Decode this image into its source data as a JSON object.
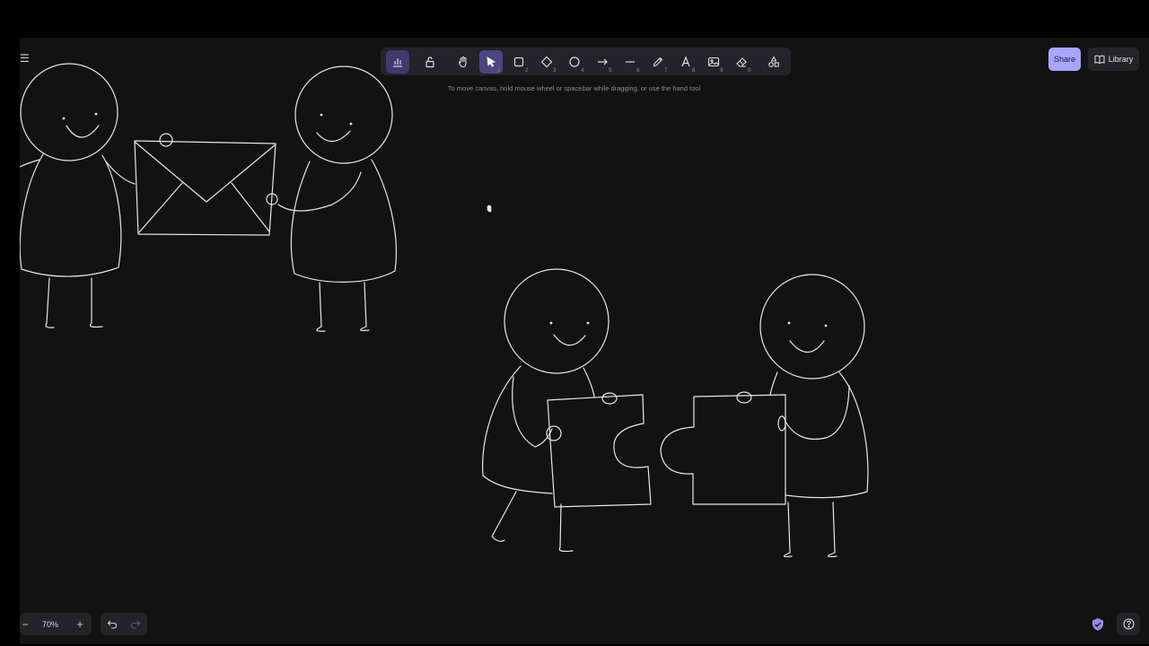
{
  "toolbar": {
    "tools": [
      {
        "id": "lock-toggle",
        "icon": "keep-tool-active-icon",
        "shortcut": ""
      },
      {
        "id": "lock",
        "icon": "lock-open-icon",
        "shortcut": ""
      },
      {
        "id": "hand",
        "icon": "hand-icon",
        "shortcut": ""
      },
      {
        "id": "selection",
        "icon": "cursor-icon",
        "shortcut": "1"
      },
      {
        "id": "rectangle",
        "icon": "square-icon",
        "shortcut": "2"
      },
      {
        "id": "diamond",
        "icon": "diamond-icon",
        "shortcut": "3"
      },
      {
        "id": "ellipse",
        "icon": "circle-icon",
        "shortcut": "4"
      },
      {
        "id": "arrow",
        "icon": "arrow-icon",
        "shortcut": "5"
      },
      {
        "id": "line",
        "icon": "line-icon",
        "shortcut": "6"
      },
      {
        "id": "draw",
        "icon": "pencil-icon",
        "shortcut": "7"
      },
      {
        "id": "text",
        "icon": "text-icon",
        "shortcut": "8"
      },
      {
        "id": "image",
        "icon": "image-icon",
        "shortcut": "9"
      },
      {
        "id": "eraser",
        "icon": "eraser-icon",
        "shortcut": "0"
      },
      {
        "id": "more",
        "icon": "shapes-icon",
        "shortcut": ""
      }
    ]
  },
  "hint": "To move canvas, hold mouse wheel or spacebar while dragging, or use the hand tool",
  "header": {
    "share_label": "Share",
    "library_label": "Library"
  },
  "footer": {
    "zoom": "70%",
    "zoom_out": "−",
    "zoom_in": "+"
  },
  "colors": {
    "canvas": "#121212",
    "stroke": "#e6e6e6",
    "accent": "#a8a5ff",
    "panel": "#232329"
  }
}
